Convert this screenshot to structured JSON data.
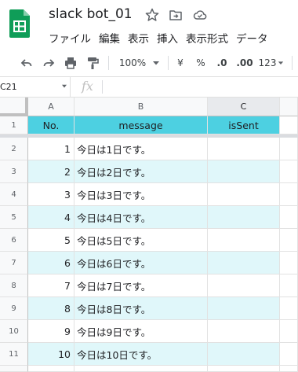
{
  "app": {
    "document_title": "slack bot_01",
    "logo_icon": "google-sheets-icon",
    "accent_color": "#0f9d58"
  },
  "menu": [
    "ファイル",
    "編集",
    "表示",
    "挿入",
    "表示形式",
    "データ"
  ],
  "toolbar": {
    "zoom": "100%",
    "currency_label": "¥",
    "percent_label": "%",
    "decrease_decimal_label": ".0",
    "increase_decimal_label": ".00",
    "more_formats_label": "123"
  },
  "formula_bar": {
    "cell_reference": "C21",
    "fx_label": "fx",
    "value": ""
  },
  "grid": {
    "columns": [
      "A",
      "B",
      "C"
    ],
    "row_numbers": [
      "1",
      "2",
      "3",
      "4",
      "5",
      "6",
      "7",
      "8",
      "9",
      "10",
      "11"
    ],
    "header_row": [
      "No.",
      "message",
      "isSent"
    ],
    "header_fill": "#4dd0e1",
    "band_fill": "#e0f7fa",
    "rows": [
      [
        "1",
        "今日は1日です。",
        ""
      ],
      [
        "2",
        "今日は2日です。",
        ""
      ],
      [
        "3",
        "今日は3日です。",
        ""
      ],
      [
        "4",
        "今日は4日です。",
        ""
      ],
      [
        "5",
        "今日は5日です。",
        ""
      ],
      [
        "6",
        "今日は6日です。",
        ""
      ],
      [
        "7",
        "今日は7日です。",
        ""
      ],
      [
        "8",
        "今日は8日です。",
        ""
      ],
      [
        "9",
        "今日は9日です。",
        ""
      ],
      [
        "10",
        "今日は10日です。",
        ""
      ]
    ]
  }
}
